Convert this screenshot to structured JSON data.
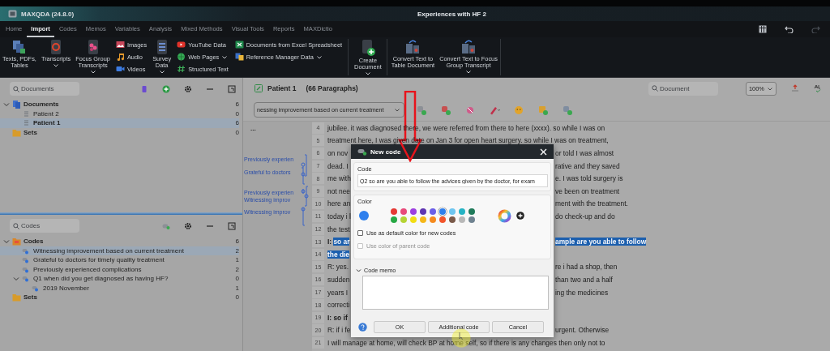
{
  "window": {
    "app_title": "MAXQDA (24.8.0)",
    "project_title": "Experiences with HF 2"
  },
  "tabs": [
    {
      "label": "Home",
      "selected": false
    },
    {
      "label": "Import",
      "selected": true
    },
    {
      "label": "Codes",
      "selected": false
    },
    {
      "label": "Memos",
      "selected": false
    },
    {
      "label": "Variables",
      "selected": false
    },
    {
      "label": "Analysis",
      "selected": false
    },
    {
      "label": "Mixed Methods",
      "selected": false
    },
    {
      "label": "Visual Tools",
      "selected": false
    },
    {
      "label": "Reports",
      "selected": false
    },
    {
      "label": "MAXDictio",
      "selected": false
    }
  ],
  "ribbon": [
    {
      "kind": "large",
      "label": "Texts, PDFs,\nTables",
      "caret": false
    },
    {
      "kind": "large",
      "label": "Transcripts",
      "caret": true
    },
    {
      "kind": "large",
      "label": "Focus Group\nTranscripts",
      "caret": true
    },
    {
      "kind": "stack",
      "items": [
        {
          "label": "Images",
          "caret": false
        },
        {
          "label": "Audio",
          "caret": false
        },
        {
          "label": "Videos",
          "caret": false
        }
      ]
    },
    {
      "kind": "large",
      "label": "Survey\nData",
      "caret": true
    },
    {
      "kind": "stack",
      "items": [
        {
          "label": "YouTube Data",
          "caret": false
        },
        {
          "label": "Web Pages",
          "caret": true
        },
        {
          "label": "Structured Text",
          "caret": false
        }
      ]
    },
    {
      "kind": "stack",
      "items": [
        {
          "label": "Documents from Excel Spreadsheet",
          "caret": false
        },
        {
          "label": "Reference Manager Data",
          "caret": true
        }
      ]
    },
    {
      "kind": "large",
      "label": "Create\nDocument",
      "caret": true
    },
    {
      "kind": "large",
      "label": "Convert Text to\nTable Document",
      "caret": false
    },
    {
      "kind": "large",
      "label": "Convert Text to Focus\nGroup Transcript",
      "caret": true
    }
  ],
  "documents": {
    "search_placeholder": "Documents",
    "tree": [
      {
        "kind": "docs-root",
        "label": "Documents",
        "count": "6",
        "expanded": true,
        "selected": false,
        "children": [
          {
            "kind": "doc",
            "label": "Patient 2",
            "count": "0",
            "selected": false
          },
          {
            "kind": "doc",
            "label": "Patient 1",
            "count": "6",
            "selected": true
          }
        ]
      },
      {
        "kind": "sets",
        "label": "Sets",
        "count": "0",
        "selected": false
      }
    ]
  },
  "codes": {
    "search_placeholder": "Codes",
    "tree": [
      {
        "kind": "codes-root",
        "label": "Codes",
        "count": "6",
        "expanded": true,
        "selected": false,
        "children": [
          {
            "kind": "code",
            "label": "Witnessing improvement based on current treatment",
            "count": "2",
            "selected": true
          },
          {
            "kind": "code",
            "label": "Grateful to doctors for timely quality treatment",
            "count": "1",
            "selected": false
          },
          {
            "kind": "code",
            "label": "Previously experienced complications",
            "count": "2",
            "selected": false
          },
          {
            "kind": "code",
            "label": "Q1 when did you get diagnosed as having HF?",
            "count": "0",
            "expanded": true,
            "selected": false,
            "children": [
              {
                "kind": "code",
                "label": "2019 November",
                "count": "1",
                "selected": false
              }
            ]
          }
        ]
      },
      {
        "kind": "sets",
        "label": "Sets",
        "count": "0",
        "selected": false
      }
    ]
  },
  "document": {
    "title": "Patient 1",
    "paragraph_count": "(66 Paragraphs)",
    "code_dropdown": "nessing improvement based on current treatment",
    "search_placeholder": "Document",
    "zoom": "100%",
    "more": "...",
    "margin_codes": [
      {
        "label": "Previously experien"
      },
      {
        "label": "Grateful to doctors"
      },
      {
        "label": "Previously experien"
      },
      {
        "label": "Witnessing improv"
      },
      {
        "label": "Witnessing improv"
      }
    ],
    "lines": [
      {
        "kind": "full",
        "number": "4",
        "text": "jubilee. it was diagnosed there, we were referred from there to here (xxxx). so while I was on"
      },
      {
        "kind": "full",
        "number": "5",
        "text": "treatment here, I was given date on Jan 3 for open heart surgery. so while I was on treatment,"
      },
      {
        "kind": "split",
        "number": "6",
        "left": "on nov",
        "right": "or told I was almost"
      },
      {
        "kind": "split",
        "number": "7",
        "left": "dead. I",
        "right": "rative and they saved"
      },
      {
        "kind": "split",
        "number": "8",
        "left": "me with",
        "right": "e. I was told surgery is"
      },
      {
        "kind": "split",
        "number": "9",
        "left": "not nee",
        "right": "ve been on treatment"
      },
      {
        "kind": "split",
        "number": "10",
        "left": "here an",
        "right": "ment with the treatment."
      },
      {
        "kind": "split",
        "number": "11",
        "left": "today i l",
        "right": "do check-up and do"
      },
      {
        "kind": "split",
        "number": "12",
        "left": "the test"
      },
      {
        "kind": "split",
        "number": "13",
        "speaker": "I:",
        "left": "so ar",
        "right": "ample are you able to follow",
        "bold": true,
        "highlighted": true
      },
      {
        "kind": "split",
        "number": "14",
        "left": "the die",
        "bold": true,
        "highlighted": true
      },
      {
        "kind": "split",
        "number": "15",
        "left": "R: yes.",
        "right": "re i had a shop, then"
      },
      {
        "kind": "split",
        "number": "16",
        "left": "sudden",
        "right": "than two and a half"
      },
      {
        "kind": "split",
        "number": "17",
        "left": "years I",
        "right": "ing the medicines"
      },
      {
        "kind": "split",
        "number": "18",
        "left": "correcti"
      },
      {
        "kind": "split",
        "number": "19",
        "speaker": "I:",
        "left": "so if",
        "bold": true,
        "highlighted": false
      },
      {
        "kind": "split",
        "number": "20",
        "left": "R: if i fe",
        "right": "urgent. Otherwise"
      },
      {
        "kind": "full",
        "number": "21",
        "text": "I will manage at home, will check BP at home self, so if there is any changes then only not to"
      }
    ]
  },
  "dialog": {
    "title": "New code",
    "code_label": "Code",
    "code_value": "Q2 so are you able to follow the advices given by the doctor, for exam",
    "color_label": "Color",
    "palette": [
      {
        "color": "#e53935",
        "selected": false
      },
      {
        "color": "#e84a7a",
        "selected": false
      },
      {
        "color": "#9c3fe0",
        "selected": false
      },
      {
        "color": "#5e35b1",
        "selected": false
      },
      {
        "color": "#6a5ee8",
        "selected": false
      },
      {
        "color": "#2f80ed",
        "selected": true
      },
      {
        "color": "#6ec6f0",
        "selected": false
      },
      {
        "color": "#26b3c4",
        "selected": false
      },
      {
        "color": "#1f7a5a",
        "selected": false
      },
      {
        "color": "#27a844",
        "selected": false
      },
      {
        "color": "#b5d334",
        "selected": false
      },
      {
        "color": "#f2dd14",
        "selected": false
      },
      {
        "color": "#f5b719",
        "selected": false
      },
      {
        "color": "#f58a1f",
        "selected": false
      },
      {
        "color": "#f2552c",
        "selected": false
      },
      {
        "color": "#7a5a4a",
        "selected": false
      },
      {
        "color": "#b8b8b8",
        "selected": false
      },
      {
        "color": "#6f8290",
        "selected": false
      }
    ],
    "options": [
      {
        "label": "Use as default color for new codes",
        "checked": false,
        "disabled": false
      },
      {
        "label": "Use color of parent code",
        "checked": false,
        "disabled": true
      }
    ],
    "memo_label": "Code memo",
    "memo_expanded": true,
    "buttons": [
      {
        "label": "OK"
      },
      {
        "label": "Additional code"
      },
      {
        "label": "Cancel"
      }
    ]
  }
}
